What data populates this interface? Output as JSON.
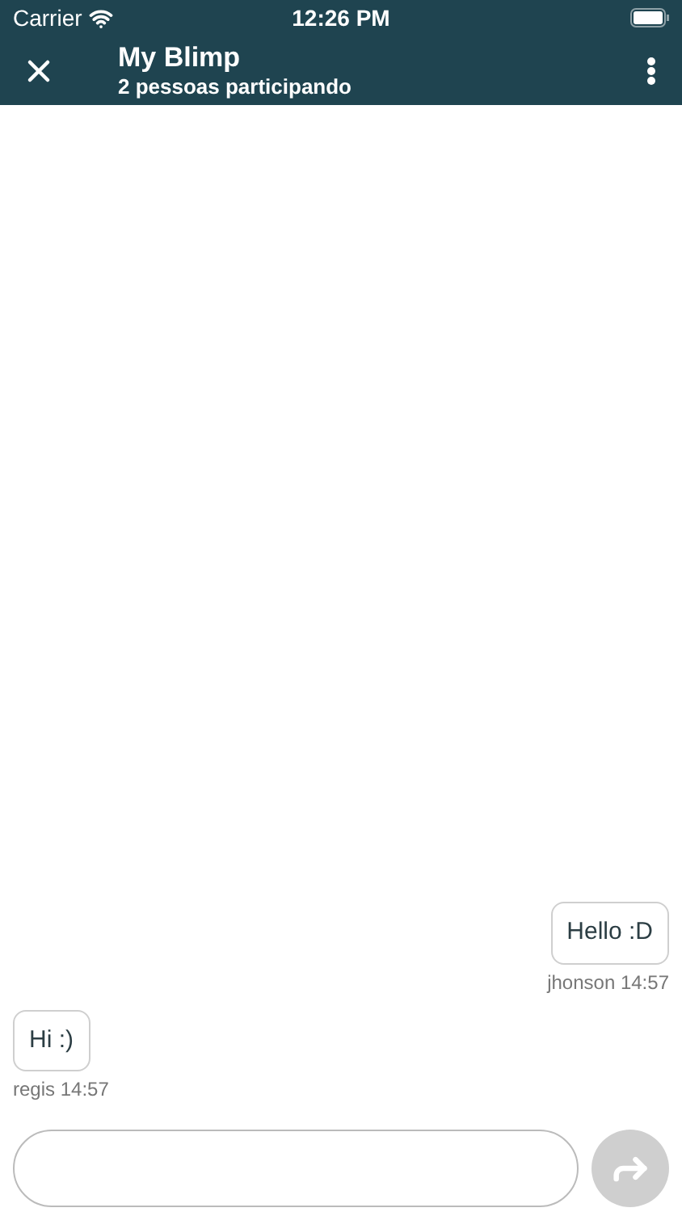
{
  "status_bar": {
    "carrier": "Carrier",
    "time": "12:26 PM"
  },
  "header": {
    "title": "My Blimp",
    "subtitle": "2 pessoas participando"
  },
  "messages": [
    {
      "kind": "outgoing",
      "text": "Hello :D",
      "meta": "jhonson 14:57"
    },
    {
      "kind": "incoming",
      "text": "Hi :)",
      "meta": "regis 14:57"
    }
  ],
  "composer": {
    "send_disabled": true
  }
}
